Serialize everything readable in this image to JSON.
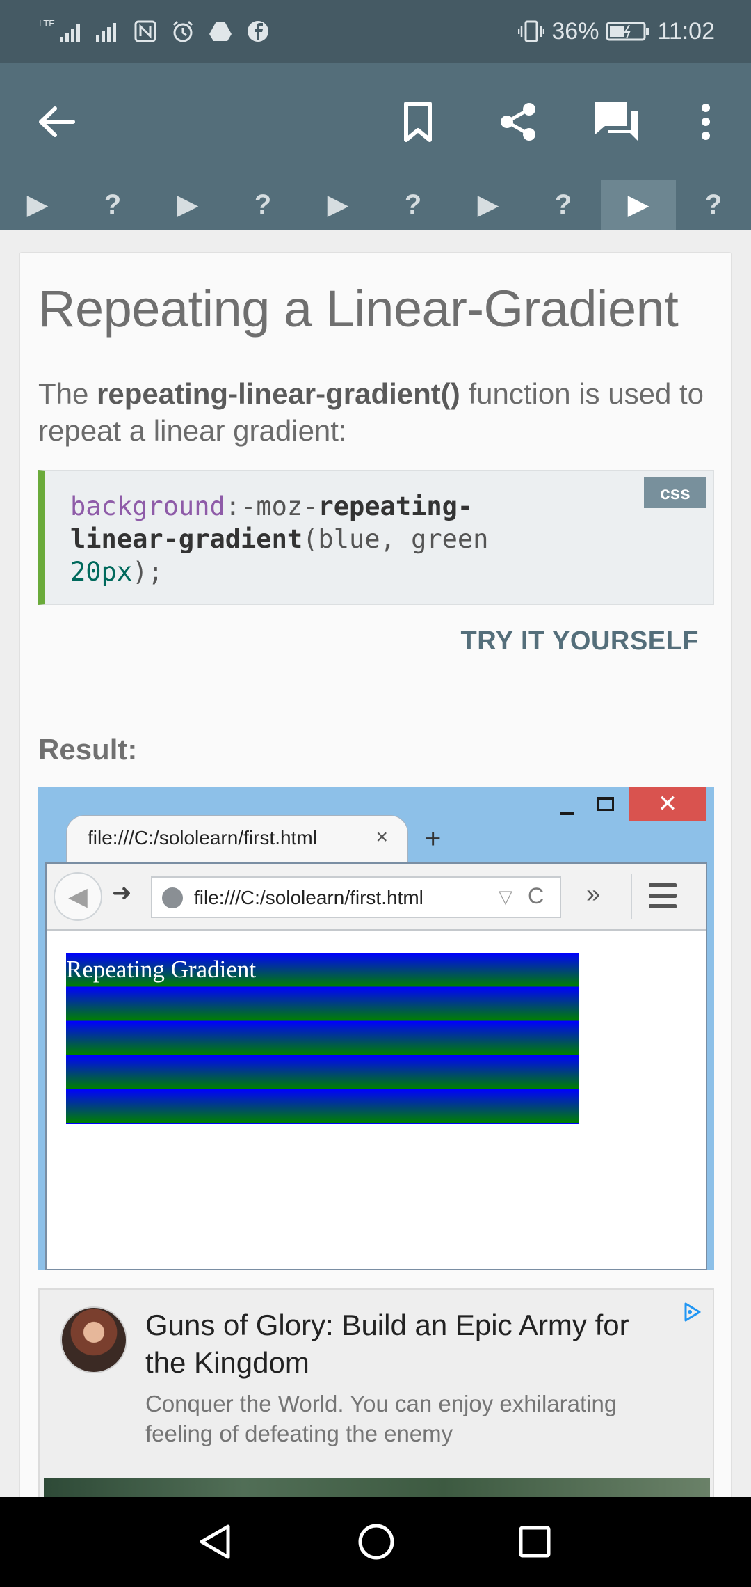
{
  "status_bar": {
    "network_label": "LTE",
    "battery": "36%",
    "time": "11:02",
    "icons": [
      "lte-signal-icon",
      "signal-icon",
      "nfc-icon",
      "alarm-icon",
      "drive-icon",
      "facebook-icon",
      "vibrate-icon",
      "battery-icon"
    ]
  },
  "app_bar": {
    "icons": [
      "back-arrow-icon",
      "bookmark-icon",
      "share-icon",
      "comments-icon",
      "more-vert-icon"
    ]
  },
  "steps": [
    {
      "glyph": "▶",
      "type": "lesson"
    },
    {
      "glyph": "?",
      "type": "quiz"
    },
    {
      "glyph": "▶",
      "type": "lesson"
    },
    {
      "glyph": "?",
      "type": "quiz"
    },
    {
      "glyph": "▶",
      "type": "lesson"
    },
    {
      "glyph": "?",
      "type": "quiz"
    },
    {
      "glyph": "▶",
      "type": "lesson"
    },
    {
      "glyph": "?",
      "type": "quiz"
    },
    {
      "glyph": "▶",
      "type": "lesson",
      "active": true
    },
    {
      "glyph": "?",
      "type": "quiz"
    }
  ],
  "lesson": {
    "title": "Repeating a Linear-Gradient",
    "intro_prefix": "The ",
    "intro_bold": "repeating-linear-gradient()",
    "intro_suffix": " function is used to repeat a linear gradient:",
    "code": {
      "lang": "css",
      "prop": "background",
      "colon": ":",
      "prefix": "-moz-",
      "fn": "repeating-linear-gradient",
      "args": "(blue, green ",
      "value": "20px",
      "end": ");"
    },
    "try_label": "TRY IT YOURSELF",
    "result_label": "Result:"
  },
  "result_browser": {
    "tab_title": "file:///C:/sololearn/first.html",
    "tab_close": "×",
    "new_tab": "+",
    "close_glyph": "✕",
    "url": "file:///C:/sololearn/first.html",
    "more": "»",
    "back": "◀",
    "forward": "➜",
    "dropdown": "▽",
    "reload": "C",
    "content_text": "Repeating Gradient"
  },
  "ad": {
    "title": "Guns of Glory: Build an Epic Army for the Kingdom",
    "description": "Conquer the World. You can enjoy exhilarating feeling of defeating the enemy"
  },
  "nav_bar": {
    "icons": [
      "nav-back-icon",
      "nav-home-icon",
      "nav-recents-icon"
    ]
  },
  "colors": {
    "status_bar": "#455a64",
    "app_bar": "#546e7a",
    "accent_green": "#6aaa3a",
    "try_button": "#546e7a"
  }
}
